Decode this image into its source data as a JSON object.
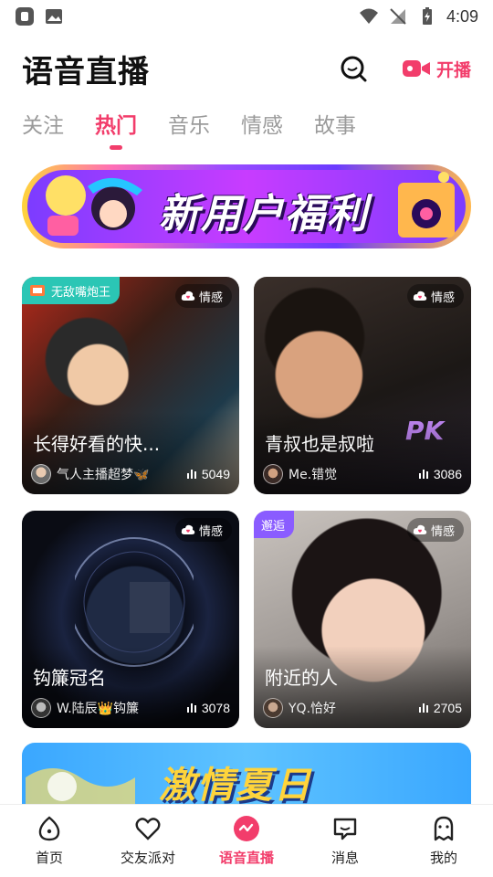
{
  "status_bar": {
    "time": "4:09"
  },
  "header": {
    "title": "语音直播",
    "live_label": "开播"
  },
  "tabs": [
    {
      "label": "关注",
      "active": false
    },
    {
      "label": "热门",
      "active": true
    },
    {
      "label": "音乐",
      "active": false
    },
    {
      "label": "情感",
      "active": false
    },
    {
      "label": "故事",
      "active": false
    }
  ],
  "banner": {
    "text": "新用户福利"
  },
  "rooms": [
    {
      "badge": "无敌嘴炮王",
      "category": "情感",
      "title": "长得好看的快...",
      "host": "气人主播超梦🦋",
      "listeners": "5049"
    },
    {
      "badge": "",
      "category": "情感",
      "title": "青叔也是叔啦",
      "host": "Me.错觉",
      "listeners": "3086"
    },
    {
      "badge": "",
      "category": "情感",
      "title": "钩簾冠名",
      "host": "W.陆辰👑钩簾",
      "listeners": "3078"
    },
    {
      "badge": "邂逅",
      "category": "情感",
      "title": "附近的人",
      "host": "YQ.恰好",
      "listeners": "2705"
    }
  ],
  "promo": {
    "text": "激情夏日"
  },
  "nav": [
    {
      "label": "首页",
      "icon": "home-icon"
    },
    {
      "label": "交友派对",
      "icon": "heart-icon"
    },
    {
      "label": "语音直播",
      "icon": "live-voice-icon"
    },
    {
      "label": "消息",
      "icon": "message-icon"
    },
    {
      "label": "我的",
      "icon": "profile-icon"
    }
  ],
  "colors": {
    "accent": "#f23d6b",
    "badge_teal": "#2bc6b5",
    "badge_purple": "#8a5cff"
  }
}
